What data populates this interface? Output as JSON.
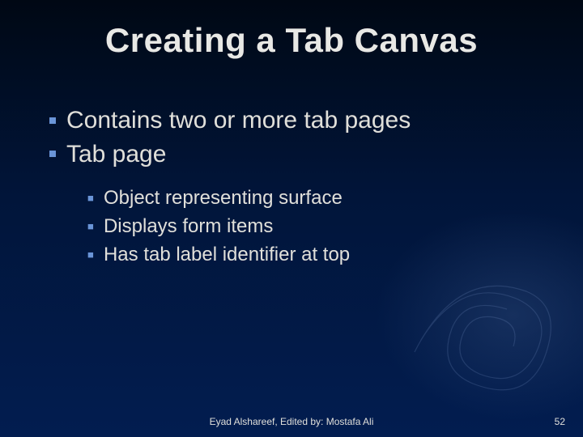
{
  "title": "Creating a Tab Canvas",
  "bullets": [
    {
      "text": "Contains two or more tab pages"
    },
    {
      "text": "Tab page"
    }
  ],
  "sub_bullets": [
    {
      "text": "Object representing surface"
    },
    {
      "text": "Displays form items"
    },
    {
      "text": "Has tab label identifier at top"
    }
  ],
  "footer_center": "Eyad Alshareef, Edited by: Mostafa Ali",
  "slide_number": "52"
}
